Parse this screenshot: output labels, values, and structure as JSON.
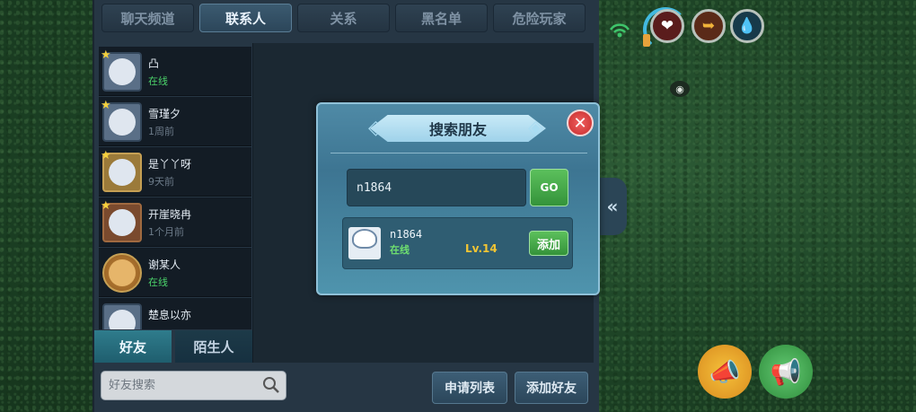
{
  "top_tabs": [
    "聊天频道",
    "联系人",
    "关系",
    "黑名单",
    "危险玩家"
  ],
  "contacts": [
    {
      "name": "凸",
      "status": "在线",
      "online": true
    },
    {
      "name": "雪瑾夕",
      "status": "1周前",
      "online": false
    },
    {
      "name": "是丫丫呀",
      "status": "9天前",
      "online": false
    },
    {
      "name": "开崖晓冉",
      "status": "1个月前",
      "online": false
    },
    {
      "name": "谢某人",
      "status": "在线",
      "online": true
    },
    {
      "name": "楚息以亦",
      "status": "",
      "online": false
    }
  ],
  "bottom_tabs": {
    "friends": "好友",
    "strangers": "陌生人"
  },
  "friend_search": {
    "placeholder": "好友搜索"
  },
  "actions": {
    "apply_list": "申请列表",
    "add_friend": "添加好友"
  },
  "modal": {
    "title": "搜索朋友",
    "input_value": "n1864",
    "go_label": "GO",
    "result": {
      "name": "n1864",
      "status": "在线",
      "level": "Lv.14",
      "add_label": "添加"
    }
  },
  "colors": {
    "online": "#4bd26a",
    "level": "#f3c533",
    "accent_button": "#3fa945"
  }
}
